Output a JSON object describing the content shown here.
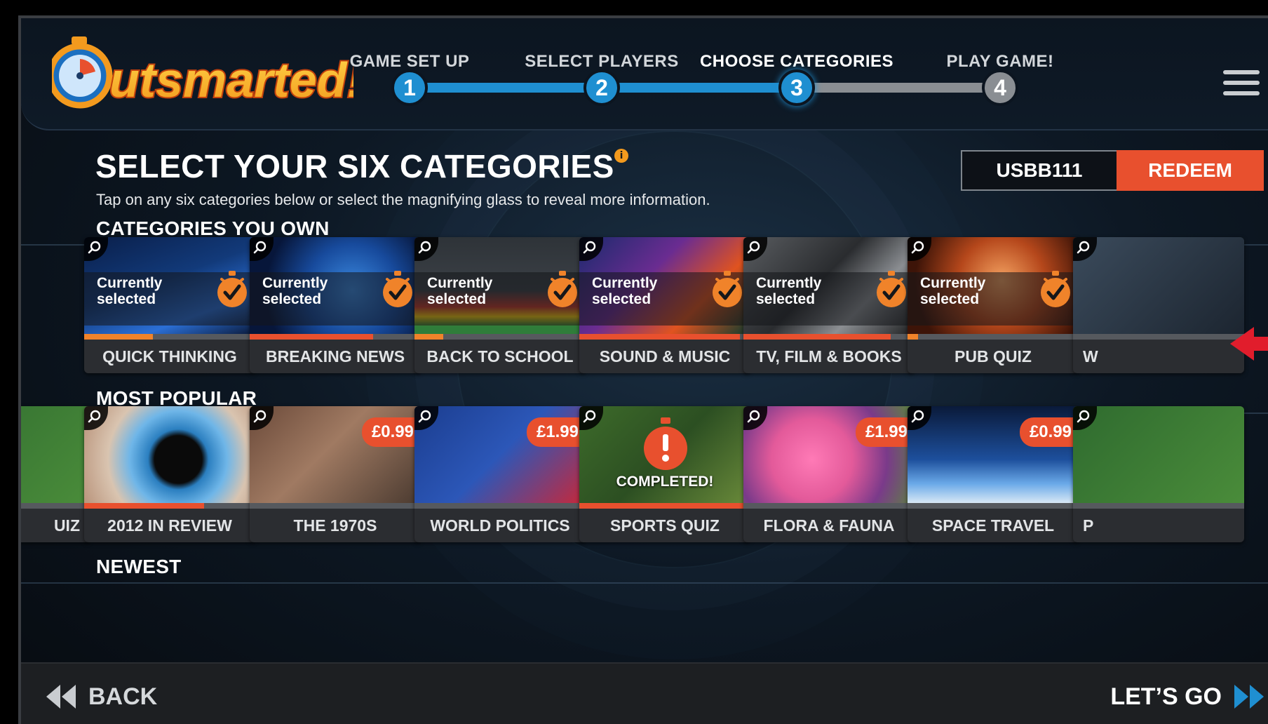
{
  "app": {
    "name": "Outsmarted!"
  },
  "stepper": {
    "steps": [
      {
        "number": "1",
        "label": "GAME SET UP",
        "state": "done"
      },
      {
        "number": "2",
        "label": "SELECT PLAYERS",
        "state": "done"
      },
      {
        "number": "3",
        "label": "CHOOSE CATEGORIES",
        "state": "active"
      },
      {
        "number": "4",
        "label": "PLAY GAME!",
        "state": "pending"
      }
    ]
  },
  "page": {
    "title": "SELECT YOUR SIX CATEGORIES",
    "subtitle": "Tap on any six categories below or select the magnifying glass to reveal more information."
  },
  "redeem": {
    "code_value": "USBB111",
    "button_label": "REDEEM"
  },
  "sections": {
    "owned": {
      "title": "CATEGORIES YOU OWN",
      "selected_label_line1": "Currently",
      "selected_label_line2": "selected",
      "cards": [
        {
          "name": "QUICK THINKING",
          "progress": 0.4,
          "progress_color": "#f0832a"
        },
        {
          "name": "BREAKING NEWS",
          "progress": 0.72,
          "progress_color": "#e8502e"
        },
        {
          "name": "BACK TO SCHOOL",
          "progress": 0.17,
          "progress_color": "#f0832a"
        },
        {
          "name": "SOUND & MUSIC",
          "progress": 0.94,
          "progress_color": "#e8502e"
        },
        {
          "name": "TV, FILM & BOOKS",
          "progress": 0.86,
          "progress_color": "#e8502e"
        },
        {
          "name": "PUB QUIZ",
          "progress": 0.06,
          "progress_color": "#f0832a"
        },
        {
          "name": "W",
          "progress": 0.0,
          "progress_color": "#f0832a"
        }
      ]
    },
    "popular": {
      "title": "MOST POPULAR",
      "cards": [
        {
          "name": "UIZ",
          "price": "",
          "progress": 0.0,
          "progress_color": "#f0832a"
        },
        {
          "name": "2012 IN REVIEW",
          "price": "",
          "progress": 0.7,
          "progress_color": "#e8502e"
        },
        {
          "name": "THE 1970S",
          "price": "£0.99",
          "progress": 0.0,
          "progress_color": "#f0832a"
        },
        {
          "name": "WORLD POLITICS",
          "price": "£1.99",
          "progress": 0.0,
          "progress_color": "#f0832a"
        },
        {
          "name": "SPORTS QUIZ",
          "price": "",
          "completed": "COMPLETED!",
          "progress": 1.0,
          "progress_color": "#e8502e"
        },
        {
          "name": "FLORA & FAUNA",
          "price": "£1.99",
          "progress": 0.0,
          "progress_color": "#f0832a"
        },
        {
          "name": "SPACE TRAVEL",
          "price": "£0.99",
          "progress": 0.0,
          "progress_color": "#f0832a"
        },
        {
          "name": "P",
          "price": "",
          "progress": 0.0,
          "progress_color": "#f0832a"
        }
      ]
    },
    "newest": {
      "title": "NEWEST"
    }
  },
  "footer": {
    "back_label": "BACK",
    "go_label": "LET’S GO"
  },
  "colors": {
    "accent_blue": "#1f8fd1",
    "accent_orange": "#f0832a",
    "accent_red": "#e8502e",
    "track_grey": "#8a8e93"
  }
}
